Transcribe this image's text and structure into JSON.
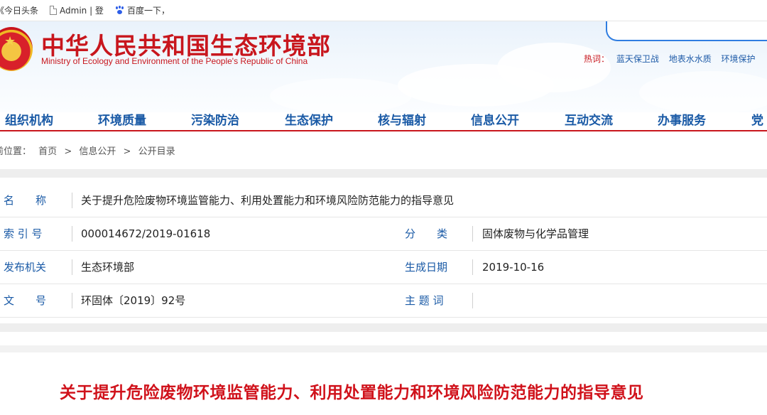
{
  "bookmarks": [
    {
      "label": "《今日头条",
      "icon": "none"
    },
    {
      "label": "Admin | 登",
      "icon": "document-icon"
    },
    {
      "label": "百度一下，",
      "icon": "baidu-paw-icon"
    }
  ],
  "site": {
    "title": "中华人民共和国生态环境部",
    "subtitle": "Ministry of Ecology and Environment of the People's Republic of China",
    "hot_label": "热词：",
    "hot_keywords": [
      "蓝天保卫战",
      "地表水水质",
      "环境保护"
    ]
  },
  "nav": [
    "组织机构",
    "环境质量",
    "污染防治",
    "生态保护",
    "核与辐射",
    "信息公开",
    "互动交流",
    "办事服务",
    "党"
  ],
  "breadcrumb": {
    "prefix": "前位置：",
    "items": [
      "首页",
      ">",
      "信息公开",
      ">",
      "公开目录"
    ]
  },
  "info": {
    "name_label": "名　　称",
    "name_value": "关于提升危险废物环境监管能力、利用处置能力和环境风险防范能力的指导意见",
    "index_label": "索 引 号",
    "index_value": "000014672/2019-01618",
    "category_label": "分　　类",
    "category_value": "固体废物与化学品管理",
    "publisher_label": "发布机关",
    "publisher_value": "生态环境部",
    "date_label": "生成日期",
    "date_value": "2019-10-16",
    "doc_label": "文　　号",
    "doc_value": "环固体〔2019〕92号",
    "subject_label": "主 题 词",
    "subject_value": ""
  },
  "article": {
    "title": "关于提升危险废物环境监管能力、利用处置能力和环境风险防范能力的指导意见"
  },
  "colors": {
    "brand_red": "#c8161d",
    "nav_blue": "#1a5aa6"
  }
}
